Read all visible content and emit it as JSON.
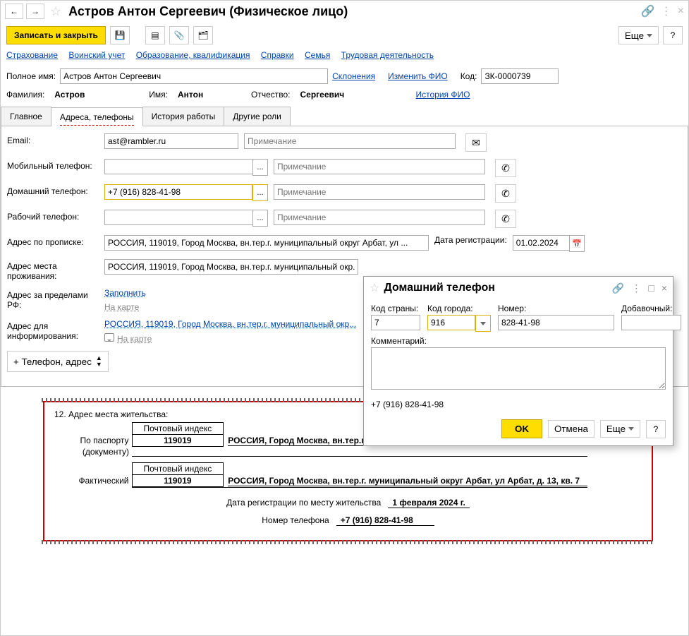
{
  "header": {
    "title": "Астров Антон Сергеевич (Физическое лицо)"
  },
  "toolbar": {
    "save_close": "Записать и закрыть",
    "more": "Еще"
  },
  "links": {
    "insurance": "Страхование",
    "military": "Воинский учет",
    "education": "Образование, квалификация",
    "refs": "Справки",
    "family": "Семья",
    "labor": "Трудовая деятельность"
  },
  "name_block": {
    "full_name_label": "Полное имя:",
    "full_name": "Астров Антон Сергеевич",
    "declensions": "Склонения",
    "change_fio": "Изменить ФИО",
    "code_label": "Код:",
    "code": "ЗК-0000739",
    "surname_label": "Фамилия:",
    "surname": "Астров",
    "name_label": "Имя:",
    "name": "Антон",
    "patronymic_label": "Отчество:",
    "patronymic": "Сергеевич",
    "history_fio": "История ФИО"
  },
  "tabs": {
    "main": "Главное",
    "addresses": "Адреса, телефоны",
    "history": "История работы",
    "roles": "Другие роли"
  },
  "form": {
    "email_label": "Email:",
    "email": "ast@rambler.ru",
    "note_placeholder": "Примечание",
    "mobile_label": "Мобильный телефон:",
    "home_label": "Домашний телефон:",
    "home_value": "+7 (916) 828-41-98",
    "work_label": "Рабочий телефон:",
    "addr_reg_label": "Адрес по прописке:",
    "addr_reg": "РОССИЯ, 119019, Город Москва, вн.тер.г. муниципальный округ Арбат, ул ...",
    "reg_date_label": "Дата регистрации:",
    "reg_date": "01.02.2024",
    "addr_live_label": "Адрес места проживания:",
    "addr_live": "РОССИЯ, 119019, Город Москва, вн.тер.г. муниципальный окр...",
    "addr_abroad_label": "Адрес за пределами РФ:",
    "fill_link": "Заполнить",
    "on_map": "На карте",
    "addr_inform_label": "Адрес для информирования:",
    "addr_inform": "РОССИЯ, 119019, Город Москва, вн.тер.г. муниципальный окр...",
    "add_btn": "+ Телефон, адрес"
  },
  "dialog": {
    "title": "Домашний телефон",
    "country_code_label": "Код страны:",
    "country_code": "7",
    "city_code_label": "Код города:",
    "city_code": "916",
    "number_label": "Номер:",
    "number": "828-41-98",
    "ext_label": "Добавочный:",
    "ext": "",
    "comment_label": "Комментарий:",
    "result": "+7 (916) 828-41-98",
    "ok": "OK",
    "cancel": "Отмена",
    "more": "Еще"
  },
  "report": {
    "heading": "12. Адрес места жительства:",
    "postal_index_label": "Почтовый индекс",
    "postal_index": "119019",
    "passport_label": "По паспорту",
    "passport_sub": "(документу)",
    "actual_label": "Фактический",
    "full_address": "РОССИЯ, Город Москва, вн.тер.г. муниципальный округ Арбат, ул Арбат, д. 13, кв. 7",
    "reg_line_label": "Дата регистрации по месту жительства",
    "reg_line_value": "1 февраля 2024 г.",
    "phone_line_label": "Номер телефона",
    "phone_line_value": "+7 (916) 828-41-98"
  }
}
